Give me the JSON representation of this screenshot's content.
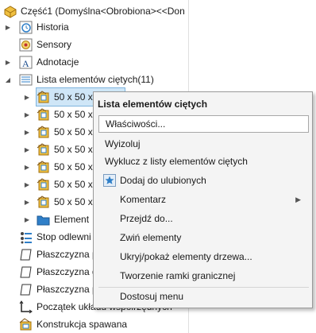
{
  "tree": {
    "root_label": "Część1  (Domyślna<Obrobiona><<Don",
    "items": [
      {
        "label": "Historia"
      },
      {
        "label": "Sensory"
      },
      {
        "label": "Adnotacje"
      },
      {
        "label": "Lista elementów ciętych(11)"
      },
      {
        "label": "50 x 50 x"
      },
      {
        "label": "50 x 50 x"
      },
      {
        "label": "50 x 50 x"
      },
      {
        "label": "50 x 50 x"
      },
      {
        "label": "50 x 50 x"
      },
      {
        "label": "50 x 50 x"
      },
      {
        "label": "50 x 50 x"
      },
      {
        "label": "Element"
      },
      {
        "label": "Stop odlewni"
      },
      {
        "label": "Płaszczyzna p"
      },
      {
        "label": "Płaszczyzna g"
      },
      {
        "label": "Płaszczyzna p"
      },
      {
        "label": "Początek układu współrzędnych"
      },
      {
        "label": "Konstrukcja spawana"
      }
    ]
  },
  "context_menu": {
    "title": "Lista elementów ciętych",
    "items": [
      {
        "label": "Właściwości..."
      },
      {
        "label": "Wyizoluj"
      },
      {
        "label": "Wyklucz z listy elementów ciętych"
      },
      {
        "label": "Dodaj do ulubionych"
      },
      {
        "label": "Komentarz"
      },
      {
        "label": "Przejdź do..."
      },
      {
        "label": "Zwiń elementy"
      },
      {
        "label": "Ukryj/pokaż elementy drzewa..."
      },
      {
        "label": "Tworzenie ramki granicznej"
      },
      {
        "label": "Dostosuj menu"
      }
    ]
  },
  "colors": {
    "selection": "#cfe6f7",
    "menu_bg": "#f4f4f4",
    "folder": "#2f7fc8"
  }
}
